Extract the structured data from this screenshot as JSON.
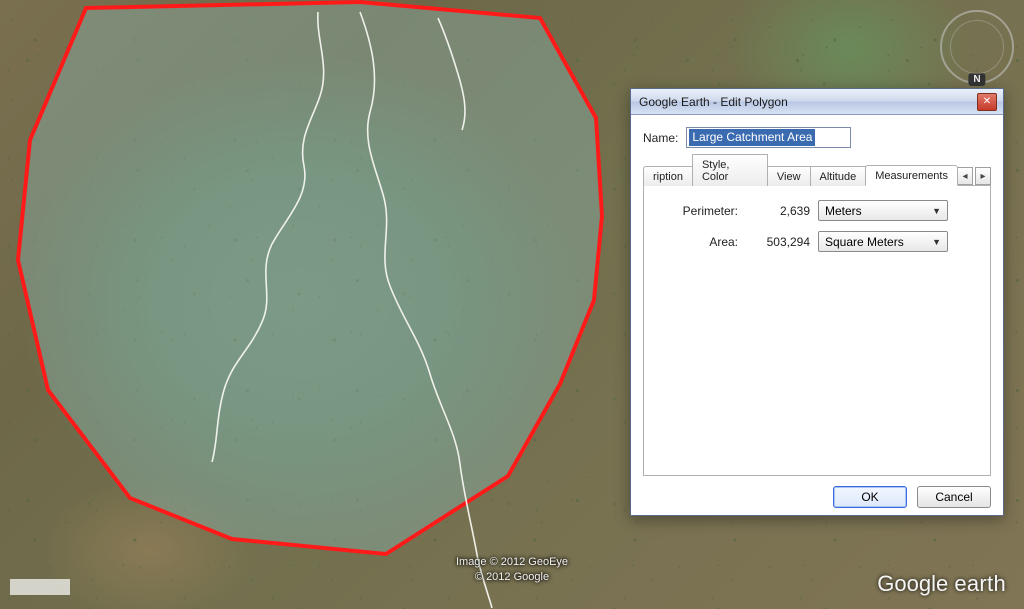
{
  "dialog": {
    "title": "Google Earth - Edit Polygon",
    "name_label": "Name:",
    "name_value": "Large Catchment Area",
    "tabs": {
      "description_partial": "ription",
      "style_color": "Style, Color",
      "view": "View",
      "altitude": "Altitude",
      "measurements": "Measurements"
    },
    "measurements": {
      "perimeter_label": "Perimeter:",
      "perimeter_value": "2,639",
      "perimeter_unit": "Meters",
      "area_label": "Area:",
      "area_value": "503,294",
      "area_unit": "Square Meters"
    },
    "buttons": {
      "ok": "OK",
      "cancel": "Cancel"
    }
  },
  "compass": {
    "north": "N"
  },
  "attribution": {
    "line1": "Image © 2012 GeoEye",
    "line2": "© 2012 Google"
  },
  "watermark": "Google earth"
}
